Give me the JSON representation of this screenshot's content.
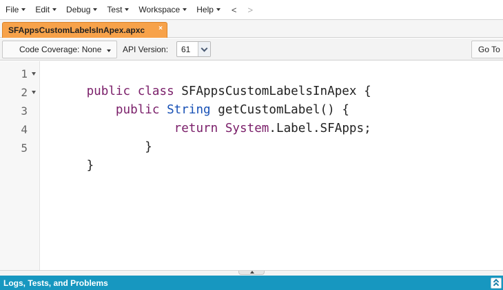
{
  "menubar": {
    "items": [
      {
        "label": "File"
      },
      {
        "label": "Edit"
      },
      {
        "label": "Debug"
      },
      {
        "label": "Test"
      },
      {
        "label": "Workspace"
      },
      {
        "label": "Help"
      }
    ],
    "back_glyph": "<",
    "forward_glyph": ">"
  },
  "tabs": [
    {
      "label": "SFAppsCustomLabelsInApex.apxc",
      "active": true,
      "close_glyph": "×"
    }
  ],
  "toolbar": {
    "coverage_label": "Code Coverage: None",
    "api_version_label": "API Version:",
    "api_version_value": "61",
    "goto_label": "Go To"
  },
  "editor": {
    "line_numbers": [
      "1",
      "2",
      "3",
      "4",
      "5"
    ],
    "foldable_lines": [
      1,
      2
    ],
    "lines": [
      {
        "segments": [
          {
            "text": "public class",
            "cls": "kw"
          },
          {
            "text": " SFAppsCustomLabelsInApex {",
            "cls": ""
          }
        ]
      },
      {
        "segments": [
          {
            "text": "    public ",
            "cls": "kw"
          },
          {
            "text": "String",
            "cls": "type"
          },
          {
            "text": " getCustomLabel() {",
            "cls": ""
          }
        ]
      },
      {
        "segments": [
          {
            "text": "            return ",
            "cls": "kw"
          },
          {
            "text": "System",
            "cls": "sys"
          },
          {
            "text": ".Label.SFApps;",
            "cls": ""
          }
        ]
      },
      {
        "segments": [
          {
            "text": "        }",
            "cls": ""
          }
        ]
      },
      {
        "segments": [
          {
            "text": "}",
            "cls": ""
          }
        ]
      }
    ]
  },
  "bottom_panel": {
    "title": "Logs, Tests, and Problems"
  },
  "colors": {
    "active_tab": "#f7a24a",
    "panel_header": "#1797c0",
    "keyword": "#7a1e69",
    "type": "#1750b5"
  },
  "icons": {
    "menu_caret": "chevron-down-icon",
    "fold": "fold-triangle-icon",
    "tab_close": "close-icon",
    "expand_panel": "double-chevron-up-icon"
  }
}
